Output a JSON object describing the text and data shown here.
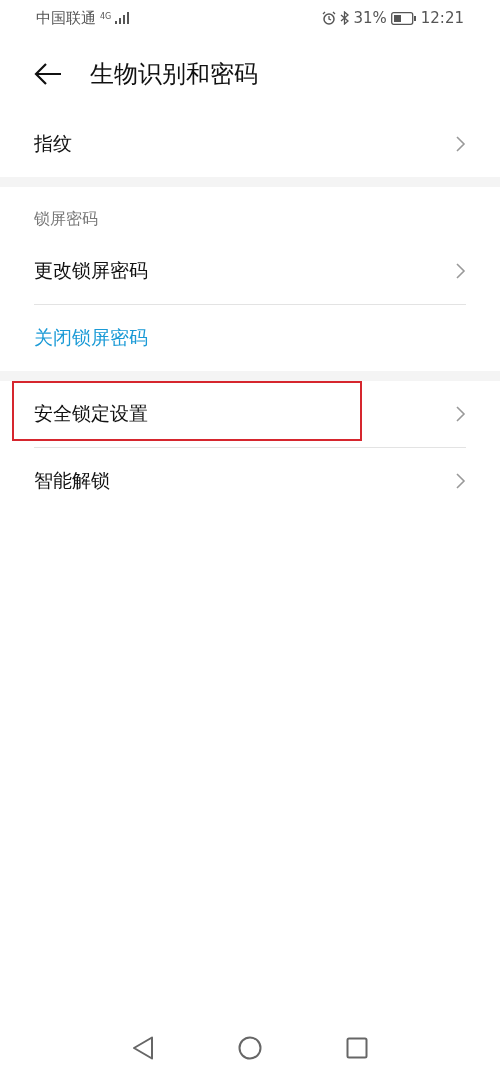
{
  "status_bar": {
    "carrier": "中国联通",
    "network": "4G",
    "battery_percent": "31%",
    "time": "12:21"
  },
  "header": {
    "title": "生物识别和密码"
  },
  "groups": [
    {
      "items": [
        {
          "label": "指纹",
          "kind": "nav",
          "highlighted": false
        }
      ]
    },
    {
      "heading": "锁屏密码",
      "items": [
        {
          "label": "更改锁屏密码",
          "kind": "nav",
          "highlighted": false
        },
        {
          "label": "关闭锁屏密码",
          "kind": "action",
          "highlighted": false
        }
      ]
    },
    {
      "items": [
        {
          "label": "安全锁定设置",
          "kind": "nav",
          "highlighted": true
        },
        {
          "label": "智能解锁",
          "kind": "nav",
          "highlighted": false
        }
      ]
    }
  ]
}
